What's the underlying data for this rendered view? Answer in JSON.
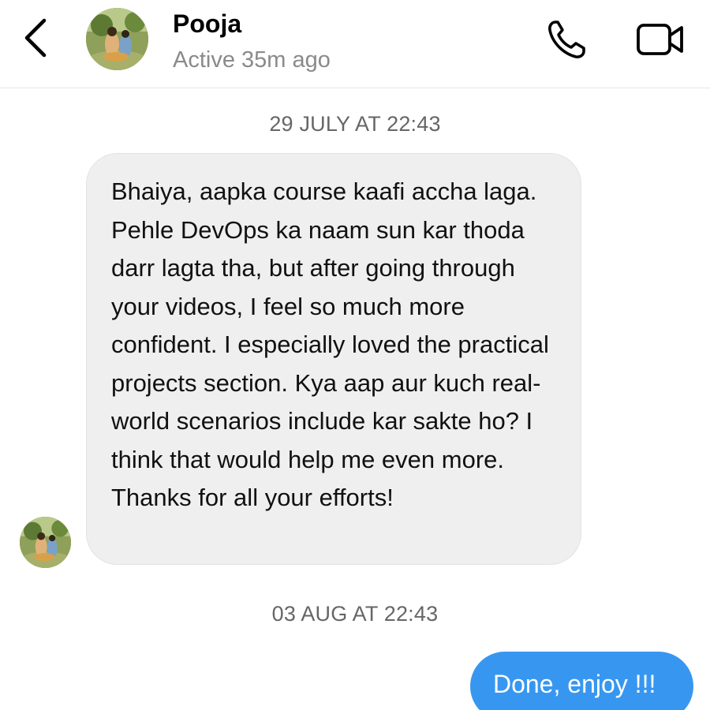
{
  "header": {
    "name": "Pooja",
    "status": "Active 35m ago",
    "icons": {
      "back": "chevron-left-icon",
      "call": "phone-icon",
      "video": "video-camera-icon"
    }
  },
  "messages": [
    {
      "timestamp": "29 JULY AT 22:43",
      "direction": "incoming",
      "text": "Bhaiya, aapka course kaafi accha laga. Pehle DevOps ka naam sun kar thoda darr lagta tha, but after going through your videos, I feel so much more confident. I especially loved the practical projects section. Kya aap aur kuch real-world scenarios include kar sakte ho? I think that would help me even more. Thanks for all your efforts!"
    },
    {
      "timestamp": "03 AUG AT 22:43",
      "direction": "outgoing",
      "text": "Done, enjoy !!!"
    }
  ],
  "colors": {
    "outgoing_bubble": "#3797f0",
    "incoming_bubble": "#efefef",
    "status_text": "#8a8a8a",
    "timestamp_text": "#666666"
  }
}
